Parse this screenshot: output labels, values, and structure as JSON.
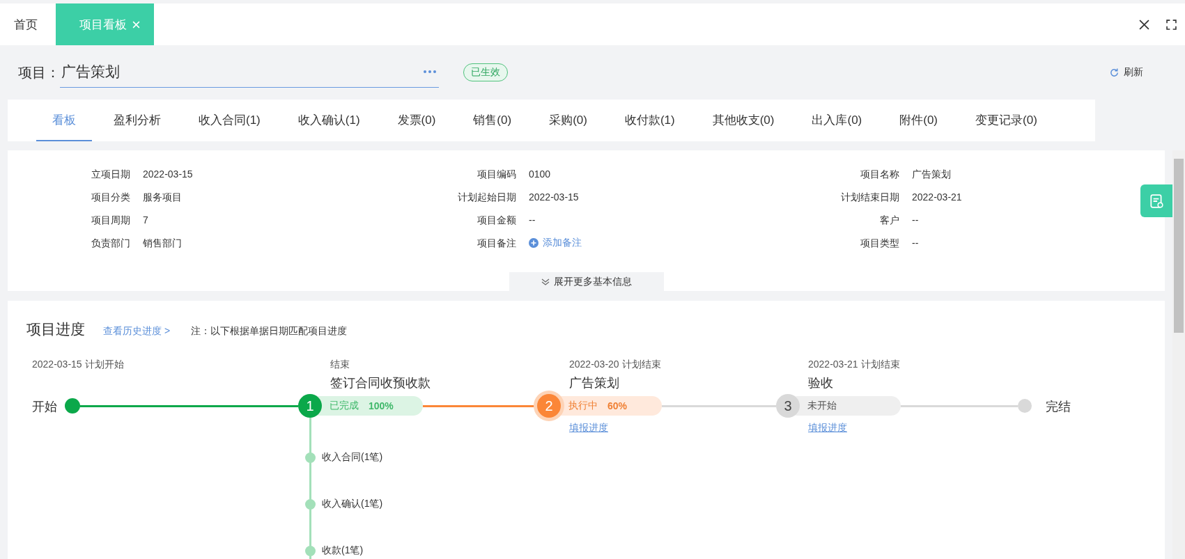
{
  "top_tabs": [
    {
      "label": "首页",
      "selected": false
    },
    {
      "label": "项目看板",
      "selected": true
    }
  ],
  "header": {
    "label": "项目：",
    "value": "广告策划",
    "status": "已生效",
    "refresh": "刷新"
  },
  "nav_tabs": [
    {
      "label": "看板",
      "selected": true
    },
    {
      "label": "盈利分析",
      "selected": false
    },
    {
      "label": "收入合同(1)",
      "selected": false
    },
    {
      "label": "收入确认(1)",
      "selected": false
    },
    {
      "label": "发票(0)",
      "selected": false
    },
    {
      "label": "销售(0)",
      "selected": false
    },
    {
      "label": "采购(0)",
      "selected": false
    },
    {
      "label": "收付款(1)",
      "selected": false
    },
    {
      "label": "其他收支(0)",
      "selected": false
    },
    {
      "label": "出入库(0)",
      "selected": false
    },
    {
      "label": "附件(0)",
      "selected": false
    },
    {
      "label": "变更记录(0)",
      "selected": false
    }
  ],
  "info": {
    "columns": [
      [
        {
          "label": "立项日期",
          "value": "2022-03-15",
          "kind": "text"
        },
        {
          "label": "项目分类",
          "value": "服务项目",
          "kind": "text"
        },
        {
          "label": "项目周期",
          "value": "7",
          "kind": "text"
        },
        {
          "label": "负责部门",
          "value": "销售部门",
          "kind": "text"
        }
      ],
      [
        {
          "label": "项目编码",
          "value": "0100",
          "kind": "text"
        },
        {
          "label": "计划起始日期",
          "value": "2022-03-15",
          "kind": "text"
        },
        {
          "label": "项目金额",
          "value": "--",
          "kind": "text"
        },
        {
          "label": "项目备注",
          "value": "添加备注",
          "kind": "link"
        }
      ],
      [
        {
          "label": "项目名称",
          "value": "广告策划",
          "kind": "text"
        },
        {
          "label": "计划结束日期",
          "value": "2022-03-21",
          "kind": "text"
        },
        {
          "label": "客户",
          "value": "--",
          "kind": "text"
        },
        {
          "label": "项目类型",
          "value": "--",
          "kind": "text"
        }
      ]
    ],
    "expand": "展开更多基本信息"
  },
  "progress": {
    "title": "项目进度",
    "history_link": "查看历史进度 >",
    "note": "注：以下根据单据日期匹配项目进度",
    "start": {
      "caption": "2022-03-15 计划开始",
      "label": "开始"
    },
    "stages": [
      {
        "number": "1",
        "caption": "结束",
        "title": "签订合同收预收款",
        "status": "已完成",
        "percent": "100%",
        "kind": "done",
        "children": [
          "收入合同(1笔)",
          "收入确认(1笔)",
          "收款(1笔)"
        ]
      },
      {
        "number": "2",
        "caption": "2022-03-20 计划结束",
        "title": "广告策划",
        "status": "执行中",
        "percent": "60%",
        "kind": "active",
        "link": "填报进度"
      },
      {
        "number": "3",
        "caption": "2022-03-21 计划结束",
        "title": "验收",
        "status": "未开始",
        "kind": "pending",
        "link": "填报进度"
      }
    ],
    "end": {
      "label": "完结"
    }
  }
}
